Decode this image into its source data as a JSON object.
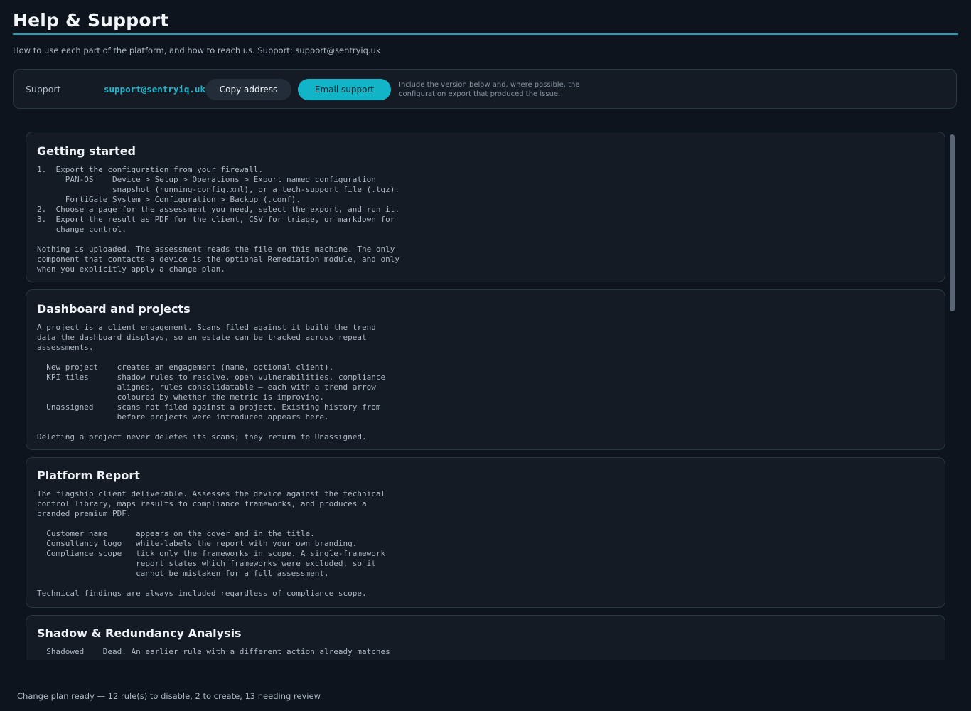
{
  "header": {
    "title": "Help & Support",
    "subtitle": "How to use each part of the platform, and how to reach us. Support: support@sentryiq.uk"
  },
  "support": {
    "label": "Support",
    "email": "support@sentryiq.uk",
    "copy_label": "Copy address",
    "email_label": "Email support",
    "note": "Include the version below and, where possible, the configuration export that produced the issue."
  },
  "sections": [
    {
      "title": "Getting started",
      "body": "1.  Export the configuration from your firewall.\n      PAN-OS    Device > Setup > Operations > Export named configuration\n                snapshot (running-config.xml), or a tech-support file (.tgz).\n      FortiGate System > Configuration > Backup (.conf).\n2.  Choose a page for the assessment you need, select the export, and run it.\n3.  Export the result as PDF for the client, CSV for triage, or markdown for\n    change control.\n\nNothing is uploaded. The assessment reads the file on this machine. The only\ncomponent that contacts a device is the optional Remediation module, and only\nwhen you explicitly apply a change plan."
    },
    {
      "title": "Dashboard and projects",
      "body": "A project is a client engagement. Scans filed against it build the trend\ndata the dashboard displays, so an estate can be tracked across repeat\nassessments.\n\n  New project    creates an engagement (name, optional client).\n  KPI tiles      shadow rules to resolve, open vulnerabilities, compliance\n                 aligned, rules consolidatable — each with a trend arrow\n                 coloured by whether the metric is improving.\n  Unassigned     scans not filed against a project. Existing history from\n                 before projects were introduced appears here.\n\nDeleting a project never deletes its scans; they return to Unassigned."
    },
    {
      "title": "Platform Report",
      "body": "The flagship client deliverable. Assesses the device against the technical\ncontrol library, maps results to compliance frameworks, and produces a\nbranded premium PDF.\n\n  Customer name      appears on the cover and in the title.\n  Consultancy logo   white-labels the report with your own branding.\n  Compliance scope   tick only the frameworks in scope. A single-framework\n                     report states which frameworks were excluded, so it\n                     cannot be mistaken for a full assessment.\n\nTechnical findings are always included regardless of compliance scope."
    },
    {
      "title": "Shadow & Redundancy Analysis",
      "body": "  Shadowed    Dead. An earlier rule with a different action already matches"
    }
  ],
  "status": {
    "text": "Change plan ready — 12 rule(s) to disable, 2 to create, 13 needing review"
  }
}
